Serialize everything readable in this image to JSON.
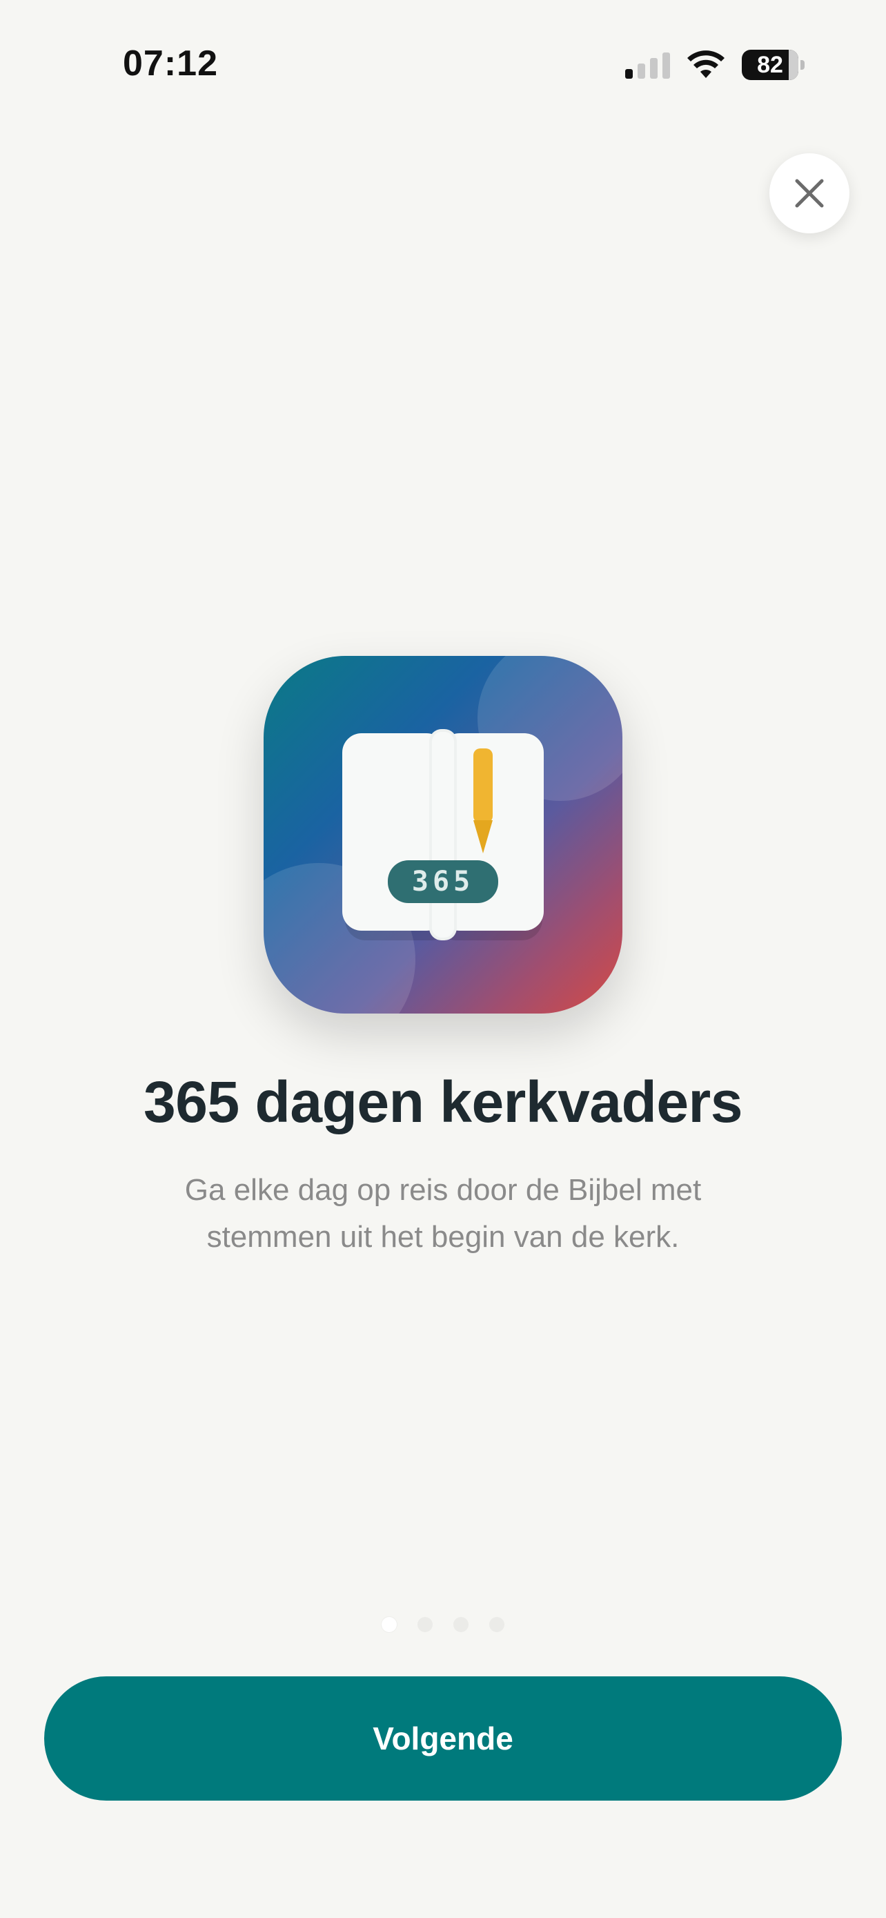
{
  "status_bar": {
    "time": "07:12",
    "battery_percent": "82",
    "icons": [
      "cellular-signal-icon",
      "wifi-icon",
      "battery-icon"
    ]
  },
  "close_button": {
    "icon": "close-icon"
  },
  "app_icon": {
    "icon": "book-pencil-icon",
    "badge_text": "365"
  },
  "onboarding": {
    "title": "365 dagen kerkvaders",
    "subtitle": "Ga elke dag op reis door de Bijbel met stemmen uit het begin van de kerk."
  },
  "pagination": {
    "total": 4,
    "current": 1
  },
  "next_button": {
    "label": "Volgende"
  },
  "colors": {
    "background": "#f6f6f3",
    "accent": "#007a7c",
    "title": "#1e2a30",
    "subtitle": "#8a8a8a",
    "pencil": "#f0b531"
  }
}
